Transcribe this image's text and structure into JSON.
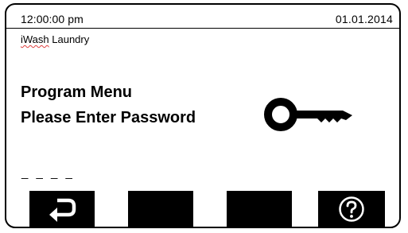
{
  "status_bar": {
    "time": "12:00:00 pm",
    "date": "01.01.2014"
  },
  "app": {
    "name_prefix": "iWash",
    "name_suffix": " Laundry"
  },
  "prompt": {
    "title": "Program Menu",
    "instruction": "Please Enter Password"
  },
  "password": {
    "mask": "_ _ _ _"
  },
  "softkeys": [
    {
      "id": "back",
      "icon": "return-arrow-icon"
    },
    {
      "id": "blank-2",
      "icon": ""
    },
    {
      "id": "blank-3",
      "icon": ""
    },
    {
      "id": "help",
      "icon": "help-icon"
    }
  ],
  "colors": {
    "background": "#ffffff",
    "foreground": "#000000",
    "spellcheck_underline": "#e04040"
  }
}
